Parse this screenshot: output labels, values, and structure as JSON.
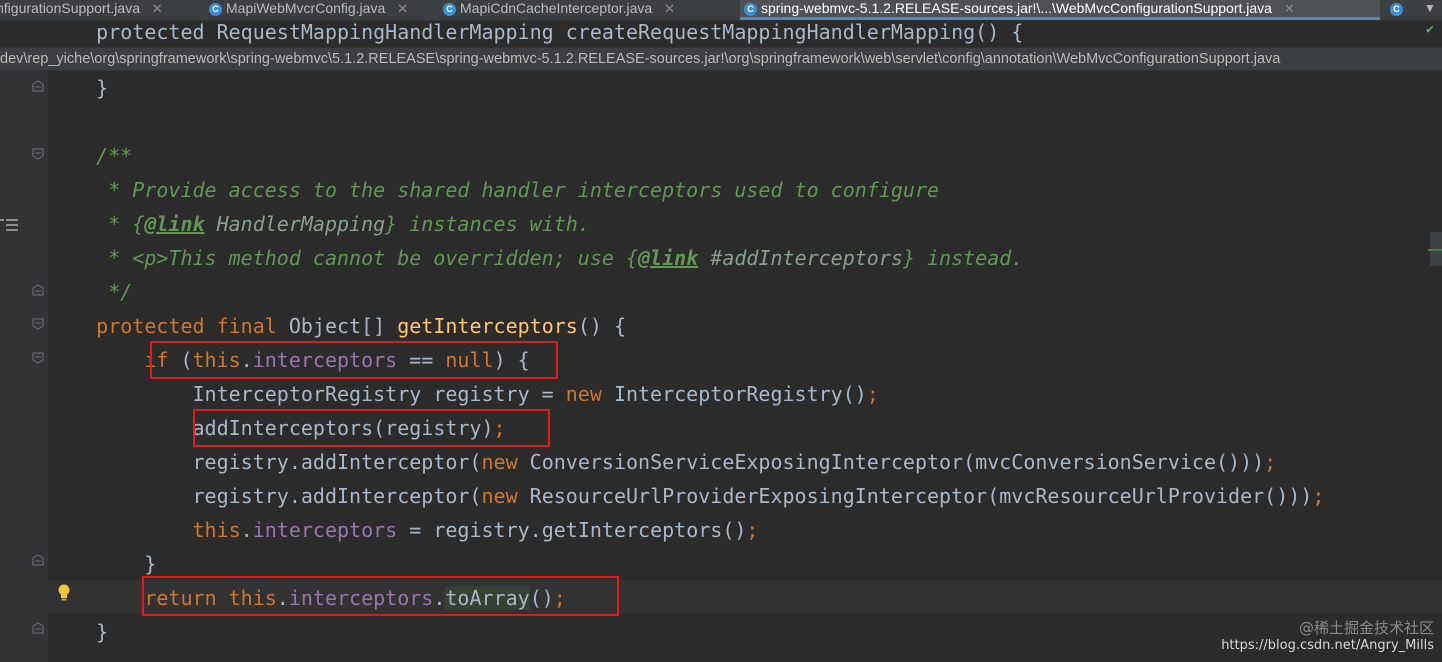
{
  "tabs": [
    {
      "label": "nfigurationSupport.java",
      "icon": "C",
      "active": false
    },
    {
      "label": "MapiWebMvcrConfig.java",
      "icon": "C",
      "active": false
    },
    {
      "label": "MapiCdnCacheInterceptor.java",
      "icon": "C",
      "active": false
    },
    {
      "label": "spring-webmvc-5.1.2.RELEASE-sources.jar!\\...\\WebMvcConfigurationSupport.java",
      "icon": "C",
      "active": true
    }
  ],
  "tab_overflow_label": "C",
  "breadcrumb": "dev\\rep_yiche\\org\\springframework\\spring-webmvc\\5.1.2.RELEASE\\spring-webmvc-5.1.2.RELEASE-sources.jar!\\org\\springframework\\web\\servlet\\config\\annotation\\WebMvcConfigurationSupport.java",
  "code": {
    "l0": "    protected RequestMappingHandlerMapping createRequestMappingHandlerMapping() {",
    "l1": "    }",
    "l3a": "    /**",
    "l4a": "     * Provide access to the shared handler interceptors used to configure",
    "l5a": "     * {",
    "l5b": "@link",
    "l5c": " HandlerMapping",
    "l5d": "} instances with.",
    "l6a": "     * <p>This method cannot be overridden; use {",
    "l6b": "@link",
    "l6c": " #addInterceptors",
    "l6d": "} instead.",
    "l7a": "     */",
    "l8a": "    protected final ",
    "l8b": "Object[] ",
    "l8c": "getInterceptors",
    "l8d": "() {",
    "l9a": "        if ",
    "l9b": "(",
    "l9c": "this",
    "l9d": ".",
    "l9e": "interceptors",
    "l9f": " == ",
    "l9g": "null",
    "l9h": ") {",
    "l10a": "            InterceptorRegistry registry = ",
    "l10b": "new ",
    "l10c": "InterceptorRegistry()",
    "l10d": ";",
    "l11a": "            addInterceptors(registry)",
    "l11b": ";",
    "l12a": "            registry.addInterceptor(",
    "l12b": "new ",
    "l12c": "ConversionServiceExposingInterceptor(mvcConversionService()))",
    "l12d": ";",
    "l13a": "            registry.addInterceptor(",
    "l13b": "new ",
    "l13c": "ResourceUrlProviderExposingInterceptor(mvcResourceUrlProvider()))",
    "l13d": ";",
    "l14a": "            ",
    "l14b": "this",
    "l14c": ".",
    "l14d": "interceptors",
    "l14e": " = registry.getInterceptors()",
    "l14f": ";",
    "l15a": "        }",
    "l16a": "        ",
    "l16b": "return ",
    "l16c": "this",
    "l16d": ".",
    "l16e": "interceptors",
    "l16f": ".",
    "l16g": "toArray",
    "l16h": "()",
    "l16i": ";",
    "l17a": "    }"
  },
  "watermark": {
    "line1": "@稀土掘金技术社区",
    "line2": "https://blog.csdn.net/Angry_Mills"
  },
  "colors": {
    "background": "#2b2b2b",
    "keyword": "#cc7832",
    "field": "#9876aa",
    "method": "#ffc66d",
    "doc_comment": "#629755",
    "highlight_box": "#e0191b"
  }
}
